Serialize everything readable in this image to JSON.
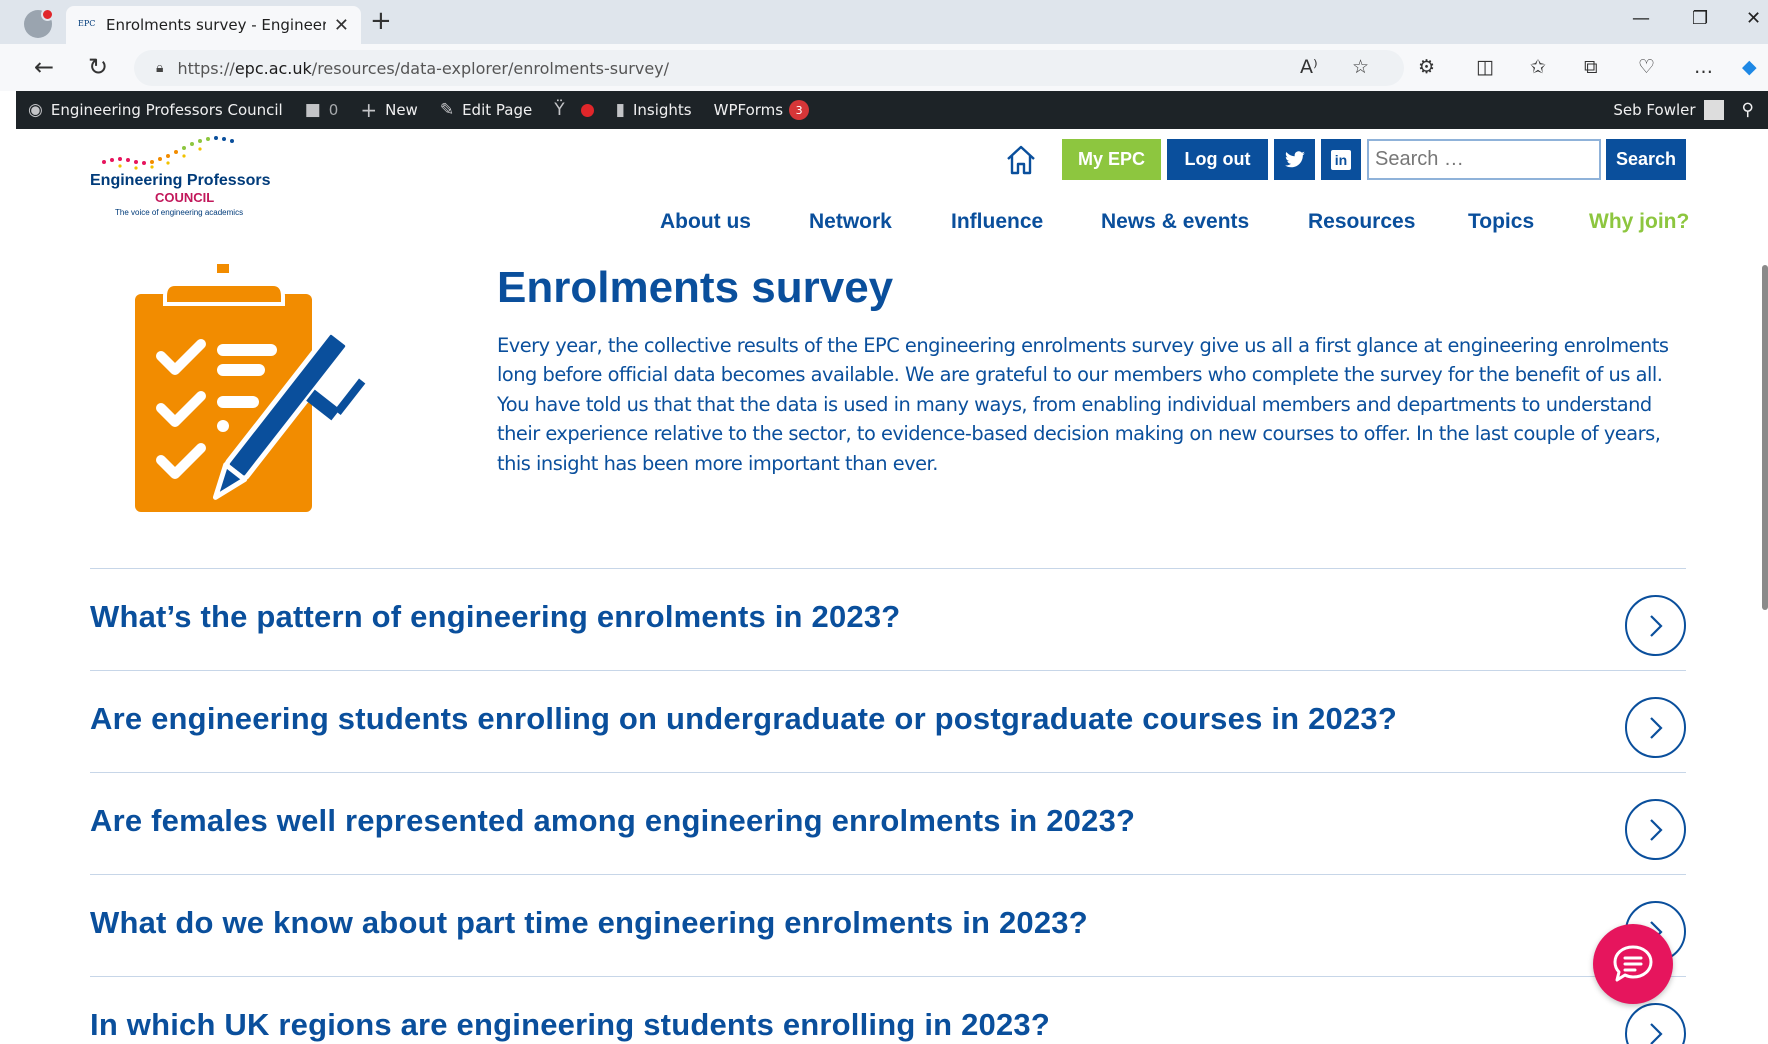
{
  "browser": {
    "tab_title": "Enrolments survey - Engineering",
    "tab_favicon": "EPC",
    "url_prefix": "https://",
    "url_host": "epc.ac.uk",
    "url_path": "/resources/data-explorer/enrolments-survey/"
  },
  "admin_bar": {
    "site_name": "Engineering Professors Council",
    "comments_count": "0",
    "new_label": "New",
    "edit_label": "Edit Page",
    "insights_label": "Insights",
    "wpforms_label": "WPForms",
    "wpforms_badge": "3",
    "user_name": "Seb Fowler"
  },
  "logo": {
    "name": "Engineering Professors",
    "council": "COUNCIL",
    "tagline": "The voice of engineering academics"
  },
  "header": {
    "my_epc": "My EPC",
    "log_out": "Log out",
    "twitter": "t",
    "linkedin": "in",
    "search_placeholder": "Search …",
    "search_button": "Search"
  },
  "nav": {
    "about": "About us",
    "network": "Network",
    "influence": "Influence",
    "news": "News & events",
    "resources": "Resources",
    "topics": "Topics",
    "why_join": "Why join?"
  },
  "hero": {
    "title": "Enrolments survey",
    "intro": "Every year, the collective results of the EPC engineering enrolments survey give us all a first glance at engineering enrolments long before official data becomes available. We are grateful to our members who complete the survey for the benefit of us all. You have told us that that the data is used in many ways, from enabling individual members and departments to understand their experience relative to the sector, to evidence-based decision making on new courses to offer. In the last couple of years, this insight has been more important than ever."
  },
  "questions": [
    "What’s the pattern of engineering enrolments in 2023?",
    "Are engineering students enrolling on undergraduate or postgraduate courses in 2023?",
    "Are females well represented among engineering enrolments in 2023?",
    "What do we know about part time engineering enrolments in 2023?",
    "In which UK regions are engineering students enrolling in 2023?"
  ],
  "colors": {
    "brand_blue": "#0a4f9c",
    "brand_green": "#8dc63f",
    "brand_orange": "#f28c00",
    "chat_pink": "#e6155d"
  }
}
